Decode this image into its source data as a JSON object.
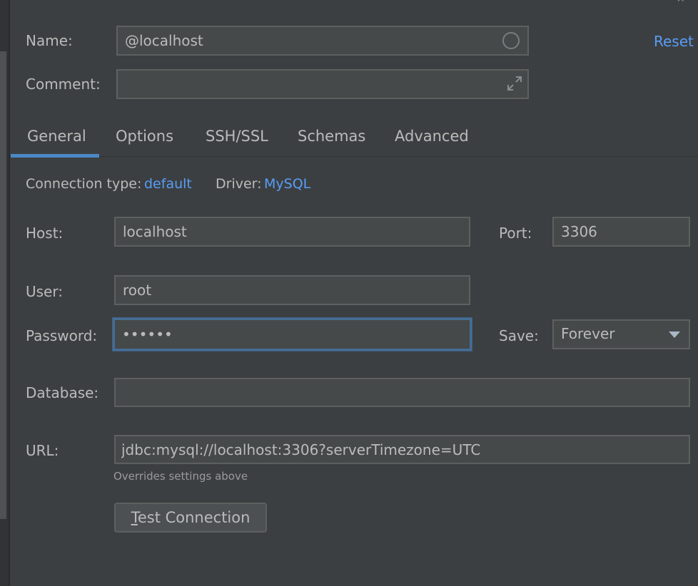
{
  "header": {
    "name_label": "Name:",
    "name_value": "@localhost",
    "comment_label": "Comment:",
    "comment_value": "",
    "reset_label": "Reset"
  },
  "tabs": [
    {
      "label": "General",
      "active": true
    },
    {
      "label": "Options",
      "active": false
    },
    {
      "label": "SSH/SSL",
      "active": false
    },
    {
      "label": "Schemas",
      "active": false
    },
    {
      "label": "Advanced",
      "active": false
    }
  ],
  "connection": {
    "type_label": "Connection type:",
    "type_value": "default",
    "driver_label": "Driver:",
    "driver_value": "MySQL"
  },
  "form": {
    "host_label": "Host:",
    "host_value": "localhost",
    "port_label": "Port:",
    "port_value": "3306",
    "user_label": "User:",
    "user_value": "root",
    "password_label": "Password:",
    "password_value": "••••••",
    "save_label": "Save:",
    "save_value": "Forever",
    "database_label": "Database:",
    "database_value": "",
    "url_label": "URL:",
    "url_value": "jdbc:mysql://localhost:3306?serverTimezone=UTC",
    "url_hint": "Overrides settings above"
  },
  "actions": {
    "test_mnemonic": "T",
    "test_rest": "est Connection"
  },
  "colors": {
    "background": "#3c3f41",
    "field": "#45494a",
    "link": "#589df6",
    "focus": "#466d94",
    "tab_underline": "#4a88c7"
  }
}
